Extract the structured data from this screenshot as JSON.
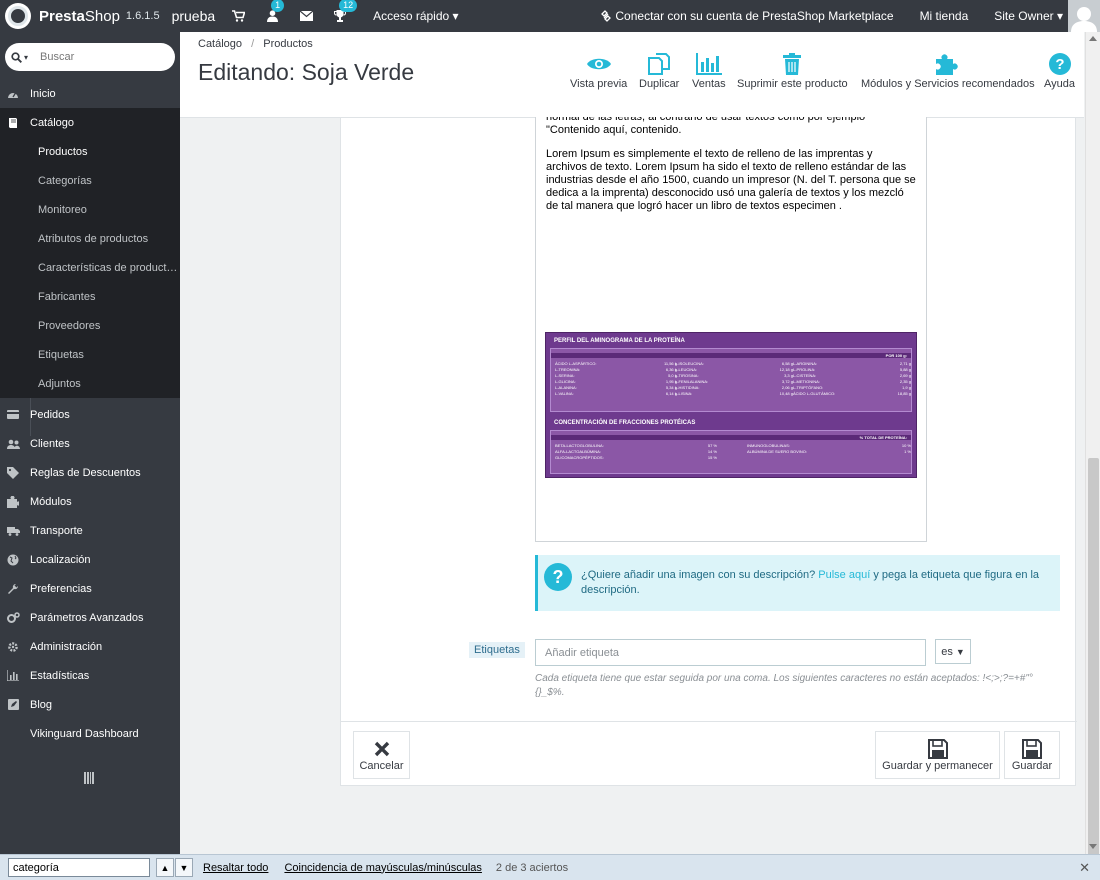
{
  "topbar": {
    "brand_pre": "Presta",
    "brand_post": "Shop",
    "version": "1.6.1.5",
    "shop_name": "prueba",
    "orders_badge": "",
    "customers_badge": "1",
    "messages_badge": "",
    "achievements_badge": "12",
    "quick_access": "Acceso rápido",
    "marketplace": "Conectar con su cuenta de PrestaShop Marketplace",
    "my_shop": "Mi tienda",
    "user": "Site Owner"
  },
  "sidebar": {
    "search_placeholder": "Buscar",
    "items": [
      {
        "label": "Inicio",
        "icon": "tachometer-icon"
      },
      {
        "label": "Catálogo",
        "icon": "book-icon"
      },
      {
        "label": "Pedidos",
        "icon": "credit-card-icon"
      },
      {
        "label": "Clientes",
        "icon": "users-icon"
      },
      {
        "label": "Reglas de Descuentos",
        "icon": "tag-icon"
      },
      {
        "label": "Módulos",
        "icon": "puzzle-icon"
      },
      {
        "label": "Transporte",
        "icon": "truck-icon"
      },
      {
        "label": "Localización",
        "icon": "globe-icon"
      },
      {
        "label": "Preferencias",
        "icon": "wrench-icon"
      },
      {
        "label": "Parámetros Avanzados",
        "icon": "cogs-icon"
      },
      {
        "label": "Administración",
        "icon": "gear-icon"
      },
      {
        "label": "Estadísticas",
        "icon": "bar-chart-icon"
      },
      {
        "label": "Blog",
        "icon": "blog-icon"
      },
      {
        "label": "Vikinguard Dashboard",
        "icon": ""
      }
    ],
    "catalog_sub": [
      "Productos",
      "Categorías",
      "Monitoreo",
      "Atributos de productos",
      "Características de product…",
      "Fabricantes",
      "Proveedores",
      "Etiquetas",
      "Adjuntos"
    ]
  },
  "header": {
    "breadcrumb_1": "Catálogo",
    "breadcrumb_sep": "/",
    "breadcrumb_2": "Productos",
    "title": "Editando: Soja Verde",
    "toolbar": {
      "preview": "Vista previa",
      "duplicate": "Duplicar",
      "sales": "Ventas",
      "delete": "Suprimir este producto",
      "modules": "Módulos y Servicios recomendados",
      "help": "Ayuda"
    }
  },
  "editor": {
    "para1": "normal de las letras, al contrario de usar textos como por ejemplo \"Contenido aquí, contenido.",
    "para2": "Lorem Ipsum es simplemente el texto de relleno de las imprentas y archivos de texto. Lorem Ipsum ha sido el texto de relleno estándar de las industrias desde el año 1500, cuando un impresor (N. del T. persona que se dedica a la imprenta) desconocido usó una galería de textos y los mezcló de tal manera que logró hacer un libro de textos especimen  .",
    "table_title_1": "PERFIL DEL AMINOGRAMA DE LA PROTEÍNA",
    "table_sub_1": "POR 100 g:",
    "rows_1": [
      [
        "ÁCIDO L-ASPÁRTICO:",
        "11,56 g",
        "L-ISOLEUCINA:",
        "6,58 g",
        "L-ARGININA:",
        "2,71 g"
      ],
      [
        "L-TREONINA:",
        "6,36 g",
        "L-LEUCINA:",
        "12,18 g",
        "L-PROLINA:",
        "5,88 g"
      ],
      [
        "L-SERINA:",
        "5,0 g",
        "L-TIROSINA:",
        "3,3 g",
        "L-CISTEÍNA:",
        "2,69 g"
      ],
      [
        "L-GLICINA:",
        "1,95 g",
        "L-FENILALANINA:",
        "3,72 g",
        "L-METIONINA:",
        "2,35 g"
      ],
      [
        "L-ALANINA:",
        "5,34 g",
        "L-HISTIDINA:",
        "2,06 g",
        "L-TRIPTÓFANO:",
        "1,9 g"
      ],
      [
        "L-VALINA:",
        "6,14 g",
        "L-LISINA:",
        "10,48 g",
        "ÁCIDO L-GLUTÁMICO:",
        "18,85 g"
      ]
    ],
    "table_title_2": "CONCENTRACIÓN DE FRACCIONES PROTÉICAS",
    "table_sub_2": "% TOTAL DE PROTEÍNA:",
    "rows_2": [
      [
        "BETA-LACTOGLOBULINA:",
        "57 %",
        "INMUNOGLOBULINAS:",
        "10 %"
      ],
      [
        "ALFA-LACTOALBÚMINA:",
        "14 %",
        "ALBÚMINA DE SUERO BOVINO:",
        "1 %"
      ],
      [
        "GLICOMACROPÉPTIDOS:",
        "15 %",
        "",
        ""
      ]
    ]
  },
  "info": {
    "text_1": "¿Quiere añadir una imagen con su descripción?",
    "link": "Pulse aquí",
    "text_2": "y pega la etiqueta que figura en la descripción."
  },
  "tags": {
    "label": "Etiquetas",
    "placeholder": "Añadir etiqueta",
    "lang": "es",
    "help": "Cada etiqueta tiene que estar seguida por una coma. Los siguientes caracteres no están aceptados: !<;>;?=+#\"°{}_$%."
  },
  "footer": {
    "cancel": "Cancelar",
    "save_stay": "Guardar y permanecer",
    "save": "Guardar"
  },
  "findbar": {
    "query": "categoría",
    "highlight_all": "Resaltar todo",
    "match_case": "Coincidencia de mayúsculas/minúsculas",
    "results": "2 de 3 aciertos"
  },
  "colors": {
    "accent": "#25b9d7",
    "sidebar": "#363a41",
    "table_purple": "#6e3a8e"
  }
}
